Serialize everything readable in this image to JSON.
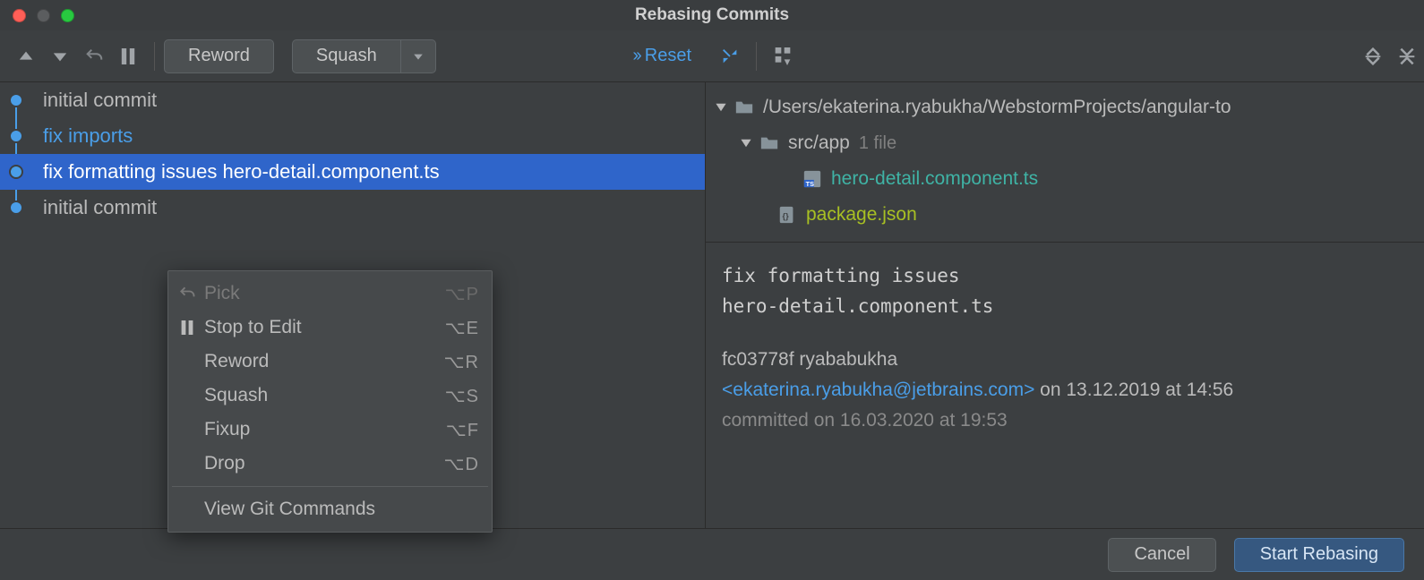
{
  "title": "Rebasing Commits",
  "toolbar": {
    "reword": "Reword",
    "squash": "Squash",
    "reset": "Reset"
  },
  "commits": [
    {
      "label": "initial commit",
      "style": "normal"
    },
    {
      "label": "fix imports",
      "style": "link"
    },
    {
      "label": "fix formatting issues hero-detail.component.ts",
      "style": "selected"
    },
    {
      "label": "initial commit",
      "style": "normal"
    }
  ],
  "context_menu": {
    "items": [
      {
        "label": "Pick",
        "shortcut": "⌥P",
        "icon": "undo",
        "disabled": true
      },
      {
        "label": "Stop to Edit",
        "shortcut": "⌥E",
        "icon": "pause",
        "disabled": false
      },
      {
        "label": "Reword",
        "shortcut": "⌥R",
        "disabled": false
      },
      {
        "label": "Squash",
        "shortcut": "⌥S",
        "disabled": false
      },
      {
        "label": "Fixup",
        "shortcut": "⌥F",
        "disabled": false
      },
      {
        "label": "Drop",
        "shortcut": "⌥D",
        "disabled": false
      }
    ],
    "footer": "View Git Commands"
  },
  "tree": {
    "root_path": "/Users/ekaterina.ryabukha/WebstormProjects/angular-to",
    "subfolder": "src/app",
    "subfolder_count": "1 file",
    "files": [
      {
        "name": "hero-detail.component.ts",
        "type": "ts"
      },
      {
        "name": "package.json",
        "type": "json"
      }
    ]
  },
  "details": {
    "message_line1": "fix formatting issues",
    "message_line2": "hero-detail.component.ts",
    "hash": "fc03778f",
    "author_name": "ryababukha",
    "author_email": "<ekaterina.ryabukha@jetbrains.com>",
    "authored_tail": " on 13.12.2019 at 14:56",
    "committed": "committed on 16.03.2020 at 19:53"
  },
  "footer": {
    "cancel": "Cancel",
    "start": "Start Rebasing"
  }
}
